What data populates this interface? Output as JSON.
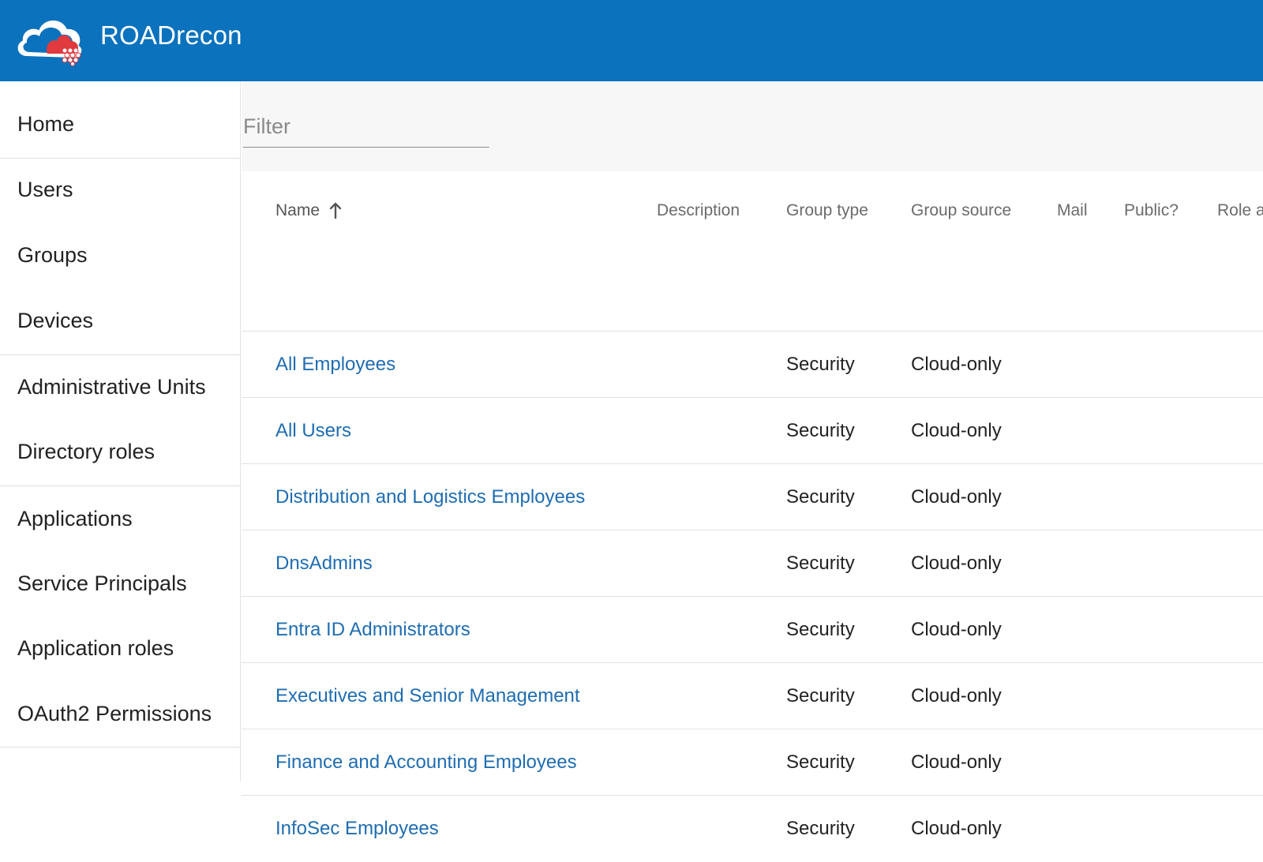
{
  "app": {
    "title": "ROADrecon"
  },
  "sidebar": {
    "items": [
      {
        "label": "Home"
      },
      {
        "label": "Users"
      },
      {
        "label": "Groups"
      },
      {
        "label": "Devices"
      },
      {
        "label": "Administrative Units"
      },
      {
        "label": "Directory roles"
      },
      {
        "label": "Applications"
      },
      {
        "label": "Service Principals"
      },
      {
        "label": "Application roles"
      },
      {
        "label": "OAuth2 Permissions"
      }
    ]
  },
  "filter": {
    "placeholder": "Filter",
    "value": ""
  },
  "table": {
    "columns": [
      {
        "label": "Name"
      },
      {
        "label": "Description"
      },
      {
        "label": "Group type"
      },
      {
        "label": "Group source"
      },
      {
        "label": "Mail"
      },
      {
        "label": "Public?"
      },
      {
        "label": "Role a"
      }
    ],
    "sort": {
      "column": "Name",
      "direction": "ascending",
      "icon": "arrow-up-icon"
    },
    "rows": [
      {
        "name": "All Employees",
        "type": "Security",
        "source": "Cloud-only"
      },
      {
        "name": "All Users",
        "type": "Security",
        "source": "Cloud-only"
      },
      {
        "name": "Distribution and Logistics Employees",
        "type": "Security",
        "source": "Cloud-only"
      },
      {
        "name": "DnsAdmins",
        "type": "Security",
        "source": "Cloud-only"
      },
      {
        "name": "Entra ID Administrators",
        "type": "Security",
        "source": "Cloud-only"
      },
      {
        "name": "Executives and Senior Management",
        "type": "Security",
        "source": "Cloud-only"
      },
      {
        "name": "Finance and Accounting Employees",
        "type": "Security",
        "source": "Cloud-only"
      },
      {
        "name": "InfoSec Employees",
        "type": "Security",
        "source": "Cloud-only"
      }
    ]
  },
  "colors": {
    "header_bg": "#0b72bd",
    "link": "#1f6db1",
    "logo_red": "#e03a3e"
  }
}
